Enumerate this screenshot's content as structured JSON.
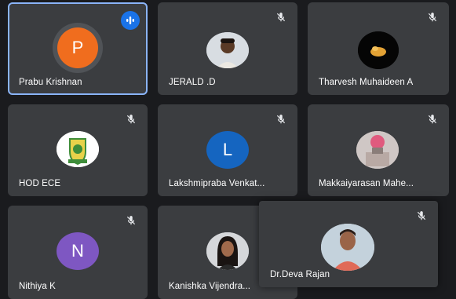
{
  "colors": {
    "background": "#1a1b1e",
    "tile": "#3b3d40",
    "active_border": "#8ab4f8",
    "speaking_indicator": "#1a73e8",
    "avatar_orange": "#f06d1e",
    "avatar_blue": "#1565c0",
    "avatar_purple": "#7e57c2"
  },
  "participants": [
    {
      "name": "Prabu Krishnan",
      "initial": "P",
      "avatar": "initial-letter",
      "state": "speaking"
    },
    {
      "name": "JERALD .D",
      "avatar": "photo",
      "state": "muted"
    },
    {
      "name": "Tharvesh Muhaideen A",
      "avatar": "photo",
      "state": "muted"
    },
    {
      "name": "HOD ECE",
      "avatar": "emblem",
      "state": "muted"
    },
    {
      "name": "Lakshmipraba Venkat...",
      "initial": "L",
      "avatar": "initial-letter",
      "state": "muted"
    },
    {
      "name": "Makkaiyarasan Mahe...",
      "avatar": "photo",
      "state": "muted"
    },
    {
      "name": "Nithiya K",
      "initial": "N",
      "avatar": "initial-letter",
      "state": "muted"
    },
    {
      "name": "Kanishka Vijendra...",
      "avatar": "photo",
      "state": "muted"
    },
    {
      "name": "Dr.Deva Rajan",
      "avatar": "photo",
      "state": "muted"
    }
  ]
}
